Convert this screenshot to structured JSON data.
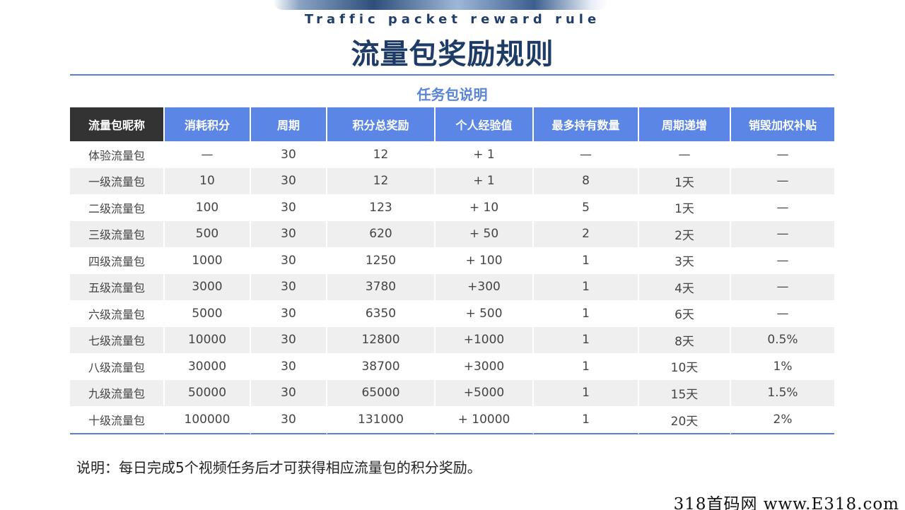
{
  "header": {
    "subtitle": "Traffic packet reward rule",
    "title": "流量包奖励规则"
  },
  "section": {
    "title": "任务包说明"
  },
  "table": {
    "columns": [
      "流量包昵称",
      "消耗积分",
      "周期",
      "积分总奖励",
      "个人经验值",
      "最多持有数量",
      "周期递增",
      "销毁加权补贴"
    ],
    "rows": [
      [
        "体验流量包",
        "—",
        "30",
        "12",
        "+ 1",
        "—",
        "—",
        "—"
      ],
      [
        "一级流量包",
        "10",
        "30",
        "12",
        "+ 1",
        "8",
        "1天",
        "—"
      ],
      [
        "二级流量包",
        "100",
        "30",
        "123",
        "+ 10",
        "5",
        "1天",
        "—"
      ],
      [
        "三级流量包",
        "500",
        "30",
        "620",
        "+ 50",
        "2",
        "2天",
        "—"
      ],
      [
        "四级流量包",
        "1000",
        "30",
        "1250",
        "+ 100",
        "1",
        "3天",
        "—"
      ],
      [
        "五级流量包",
        "3000",
        "30",
        "3780",
        "+300",
        "1",
        "4天",
        "—"
      ],
      [
        "六级流量包",
        "5000",
        "30",
        "6350",
        "+ 500",
        "1",
        "6天",
        "—"
      ],
      [
        "七级流量包",
        "10000",
        "30",
        "12800",
        "+1000",
        "1",
        "8天",
        "0.5%"
      ],
      [
        "八级流量包",
        "30000",
        "30",
        "38700",
        "+3000",
        "1",
        "10天",
        "1%"
      ],
      [
        "九级流量包",
        "50000",
        "30",
        "65000",
        "+5000",
        "1",
        "15天",
        "1.5%"
      ],
      [
        "十级流量包",
        "100000",
        "30",
        "131000",
        "+ 10000",
        "1",
        "20天",
        "2%"
      ]
    ]
  },
  "note": "说明：每日完成5个视频任务后才可获得相应流量包的积分奖励。",
  "watermark": "318首码网 www.E318.com",
  "colors": {
    "header_accent": "#5b86e6",
    "first_header": "#333333",
    "title": "#1e3c66",
    "section_title": "#5b86d8"
  }
}
